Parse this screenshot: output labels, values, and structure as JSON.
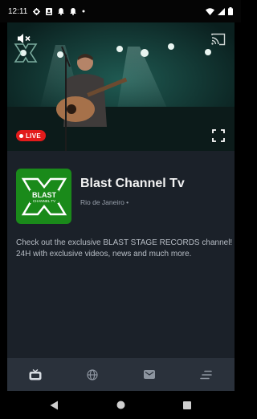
{
  "status_bar": {
    "time": "12:11",
    "icons": [
      "settings-icon",
      "contact-card-icon",
      "notification-bell-icon",
      "notification-bell-icon",
      "dot-icon"
    ],
    "right_icons": [
      "wifi-icon",
      "signal-icon",
      "battery-icon"
    ]
  },
  "player": {
    "live_label": "LIVE",
    "mute_icon": "volume-mute-icon",
    "cast_icon": "cast-icon",
    "fullscreen_icon": "fullscreen-icon",
    "live_color": "#e21b1b"
  },
  "channel": {
    "logo_text": "BLAST CHANNEL TV",
    "name": "Blast Channel Tv",
    "location": "Rio de Janeiro •",
    "description": "Check out the exclusive BLAST STAGE RECORDS channel! 24H with exclusive videos, news and much more.",
    "logo_color": "#1a8a1a"
  },
  "bottom_nav": {
    "items": [
      {
        "icon": "tv-icon",
        "active": true
      },
      {
        "icon": "globe-icon",
        "active": false
      },
      {
        "icon": "mail-icon",
        "active": false
      },
      {
        "icon": "menu-icon",
        "active": false
      }
    ]
  },
  "system_nav": {
    "buttons": [
      "back-icon",
      "home-icon",
      "recents-icon"
    ]
  }
}
